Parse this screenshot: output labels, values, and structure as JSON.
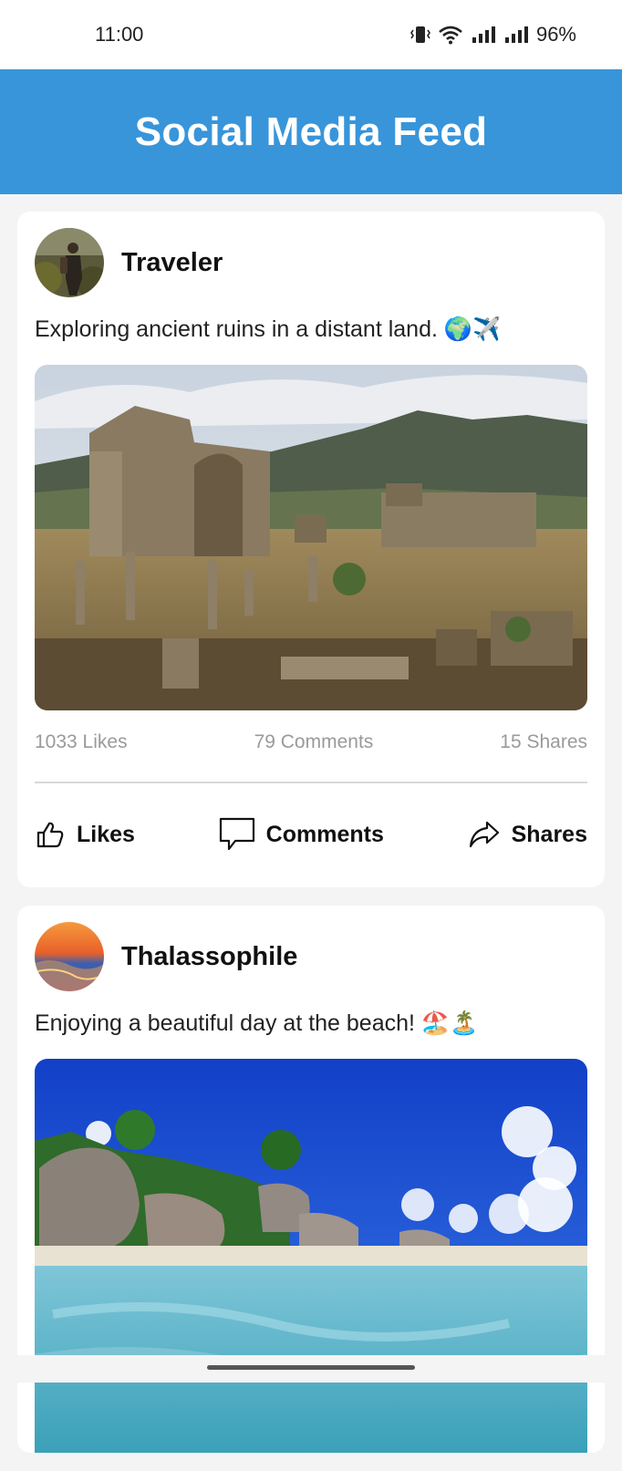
{
  "status_bar": {
    "time": "11:00",
    "battery": "96%"
  },
  "header": {
    "title": "Social Media Feed"
  },
  "posts": [
    {
      "username": "Traveler",
      "caption": "Exploring ancient ruins in a distant land. 🌍✈️",
      "stats": {
        "likes": "1033 Likes",
        "comments": "79 Comments",
        "shares": "15 Shares"
      },
      "actions": {
        "likes": "Likes",
        "comments": "Comments",
        "shares": "Shares"
      }
    },
    {
      "username": "Thalassophile",
      "caption": "Enjoying a beautiful day at the beach! 🏖️🏝️"
    }
  ]
}
